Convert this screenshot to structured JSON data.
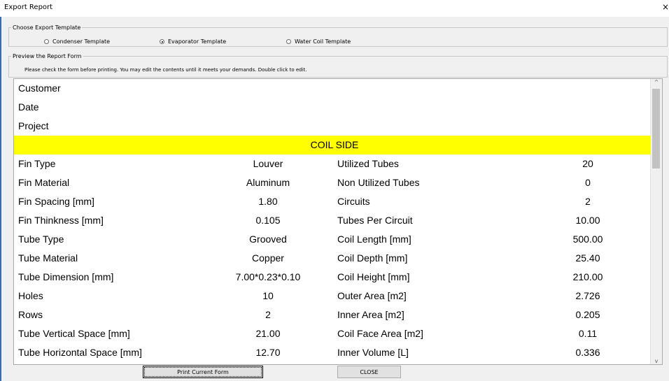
{
  "window": {
    "title": "Export Report",
    "close_glyph": "×"
  },
  "template_group": {
    "legend": "Choose Export Template",
    "options": [
      {
        "label": "Condenser Template",
        "selected": false
      },
      {
        "label": "Evaporator Template",
        "selected": true
      },
      {
        "label": "Water Coil Template",
        "selected": false
      }
    ]
  },
  "preview_group": {
    "legend": "Preview the Report Form",
    "instruction": "Please check the form before printing. You may edit the contents until it meets your demands. Double click to edit."
  },
  "report": {
    "header_rows": [
      "Customer",
      "Date",
      "Project"
    ],
    "section_title": "COIL SIDE",
    "section_color": "#ffff00",
    "rows": [
      [
        "Fin Type",
        "Louver",
        "Utilized Tubes",
        "20"
      ],
      [
        "Fin Material",
        "Aluminum",
        "Non Utilized Tubes",
        "0"
      ],
      [
        "Fin Spacing [mm]",
        "1.80",
        "Circuits",
        "2"
      ],
      [
        "Fin Thinkness [mm]",
        "0.105",
        "Tubes Per Circuit",
        "10.00"
      ],
      [
        "Tube Type",
        "Grooved",
        "Coil Length [mm]",
        "500.00"
      ],
      [
        "Tube Material",
        "Copper",
        "Coil Depth [mm]",
        "25.40"
      ],
      [
        "Tube Dimension [mm]",
        "7.00*0.23*0.10",
        "Coil Height [mm]",
        "210.00"
      ],
      [
        "Holes",
        "10",
        "Outer Area [m2]",
        "2.726"
      ],
      [
        "Rows",
        "2",
        "Inner Area [m2]",
        "0.205"
      ],
      [
        "Tube Vertical Space [mm]",
        "21.00",
        "Coil Face Area [m2]",
        "0.11"
      ],
      [
        "Tube Horizontal Space [mm]",
        "12.70",
        "Inner Volume [L]",
        "0.336"
      ]
    ]
  },
  "scrollbar": {
    "up_glyph": "^",
    "down_glyph": "v"
  },
  "buttons": {
    "print": "Print Current Form",
    "close": "CLOSE"
  }
}
